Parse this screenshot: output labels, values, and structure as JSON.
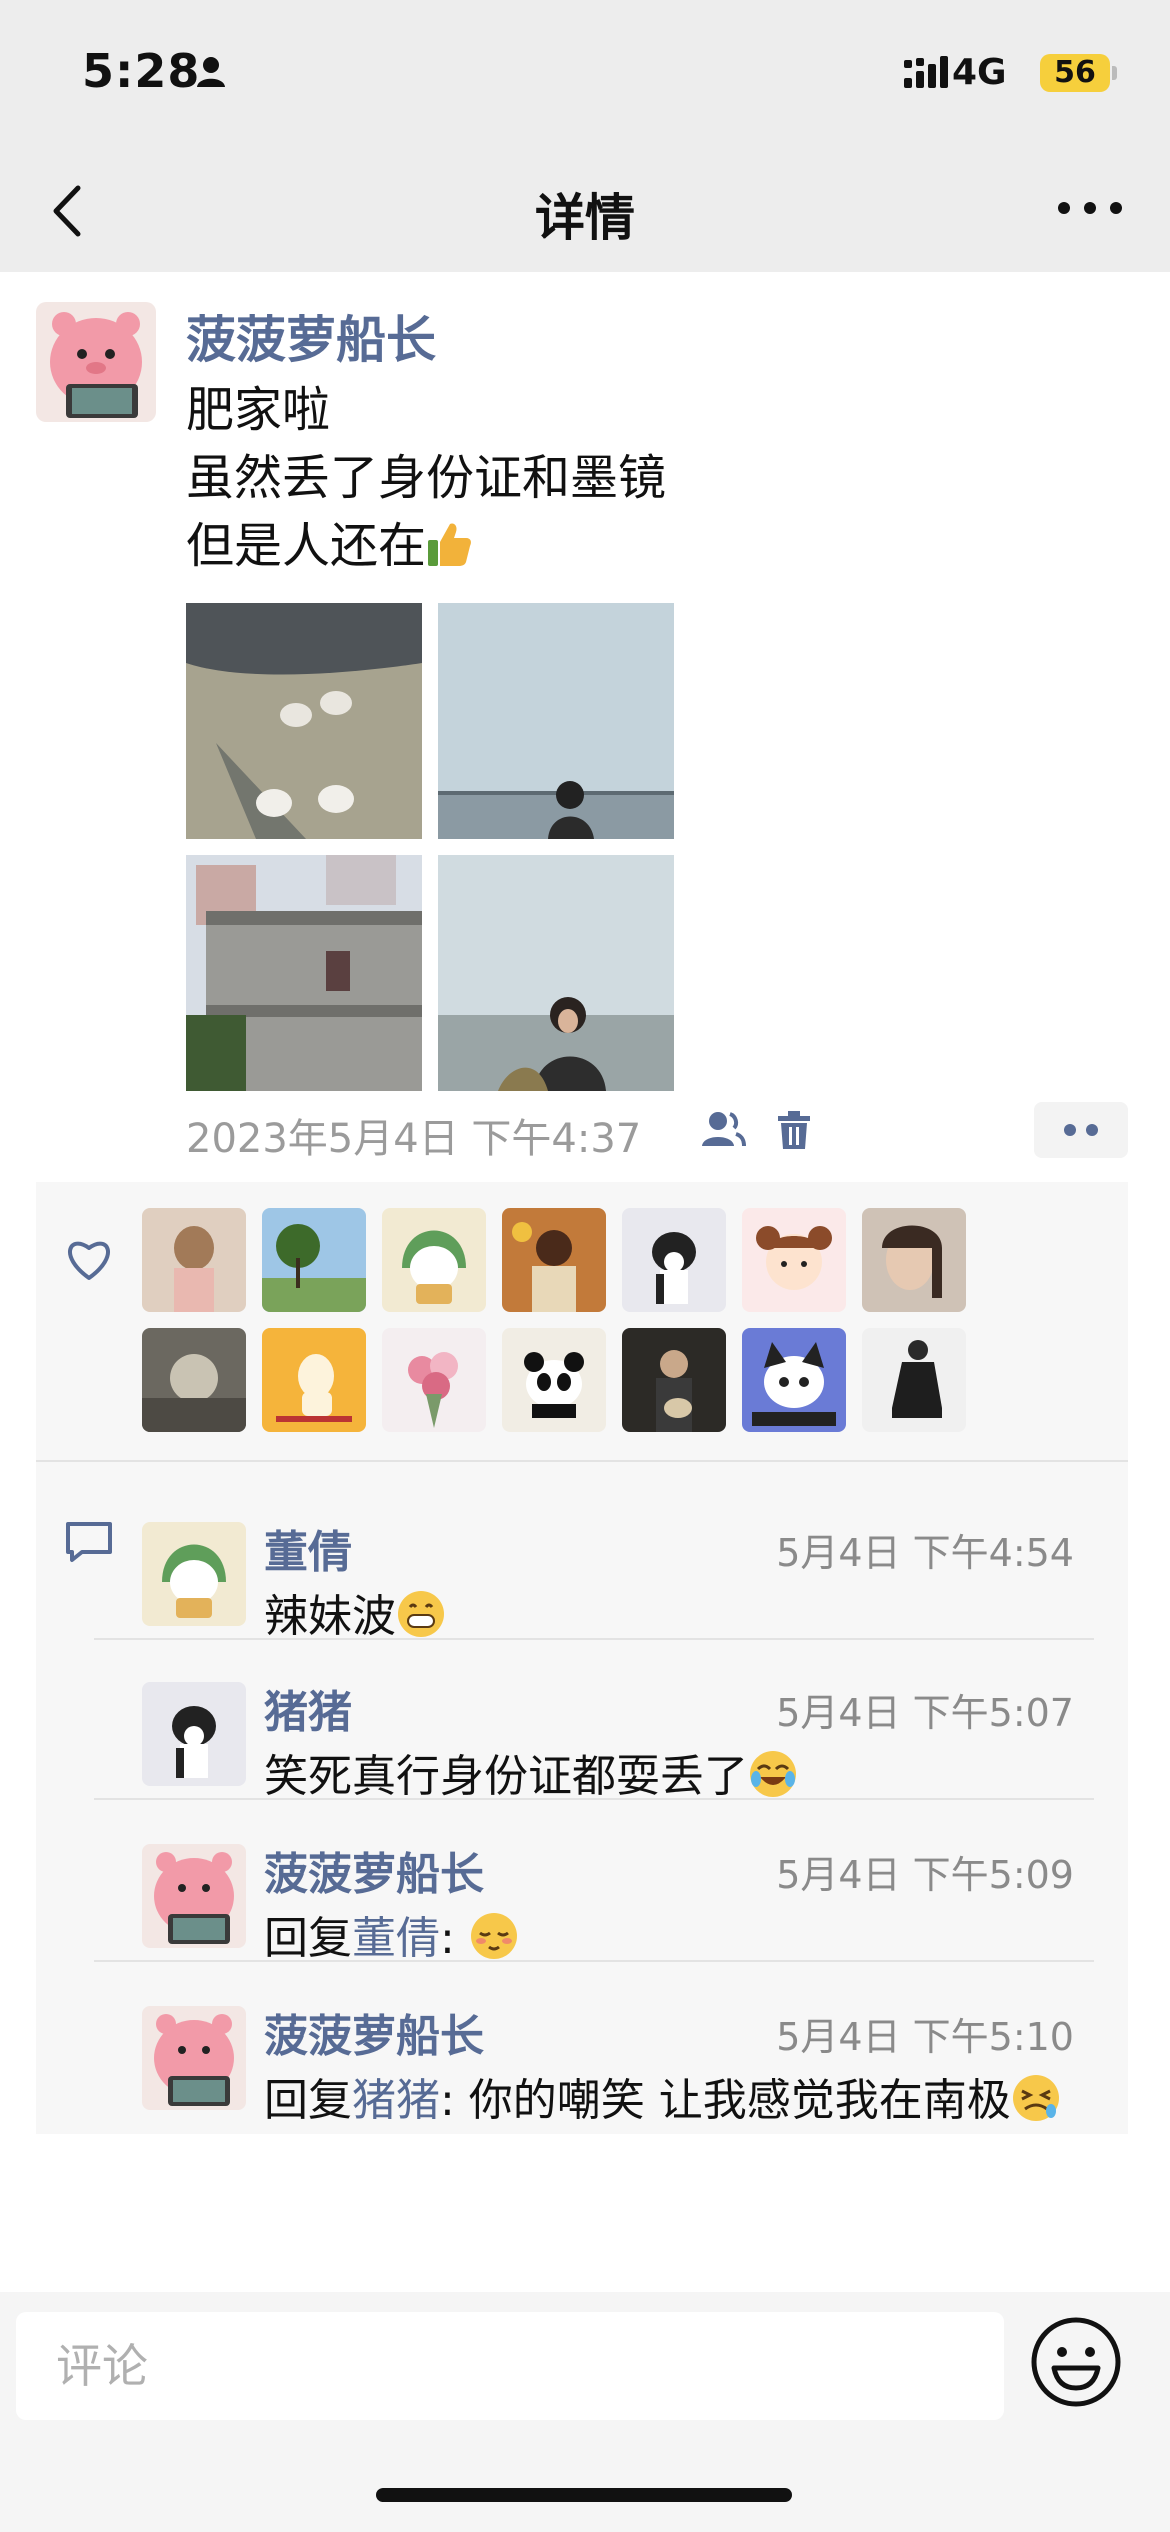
{
  "status_bar": {
    "time": "5:28",
    "network": "4G",
    "battery": "56"
  },
  "nav": {
    "title": "详情",
    "back_icon": "chevron-left-icon",
    "more_icon": "more-icon"
  },
  "post": {
    "author": "菠菠萝船长",
    "text_lines": [
      "肥家啦",
      "虽然丢了身份证和墨镜",
      "但是人还在"
    ],
    "time": "2023年5月4日 下午4:37",
    "photos": [
      "sand-feet-photo",
      "sea-girl-back-photo",
      "old-building-photo",
      "sea-girl-front-photo"
    ]
  },
  "comments": [
    {
      "name": "董倩",
      "time": "5月4日 下午4:54",
      "text": "辣妹波"
    },
    {
      "name": "猪猪",
      "time": "5月4日 下午5:07",
      "text": "笑死真行身份证都耍丢了"
    },
    {
      "name": "菠菠萝船长",
      "time": "5月4日 下午5:09",
      "reply_prefix": "回复",
      "reply_to": "董倩",
      "text": ":"
    },
    {
      "name": "菠菠萝船长",
      "time": "5月4日 下午5:10",
      "reply_prefix": "回复",
      "reply_to": "猪猪",
      "text": ": 你的嘲笑 让我感觉我在南极"
    }
  ],
  "comment_input": {
    "placeholder": "评论"
  },
  "colors": {
    "link": "#576b95",
    "nav_bg": "#ededed",
    "panel_bg": "#f7f7f7"
  }
}
